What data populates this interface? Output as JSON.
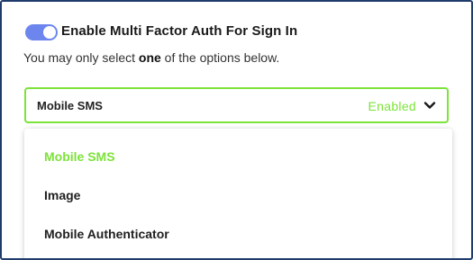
{
  "mfa": {
    "toggle_on": true,
    "title": "Enable Multi Factor Auth For Sign In",
    "hint_prefix": "You may only select ",
    "hint_bold": "one",
    "hint_suffix": " of the options below."
  },
  "select": {
    "value": "Mobile SMS",
    "status": "Enabled",
    "options": [
      "Mobile SMS",
      "Image",
      "Mobile Authenticator"
    ],
    "selected_index": 0
  },
  "colors": {
    "accent_green": "#7ce33a",
    "toggle_blue": "#6d86ee",
    "frame_border": "#1f3c6b"
  }
}
